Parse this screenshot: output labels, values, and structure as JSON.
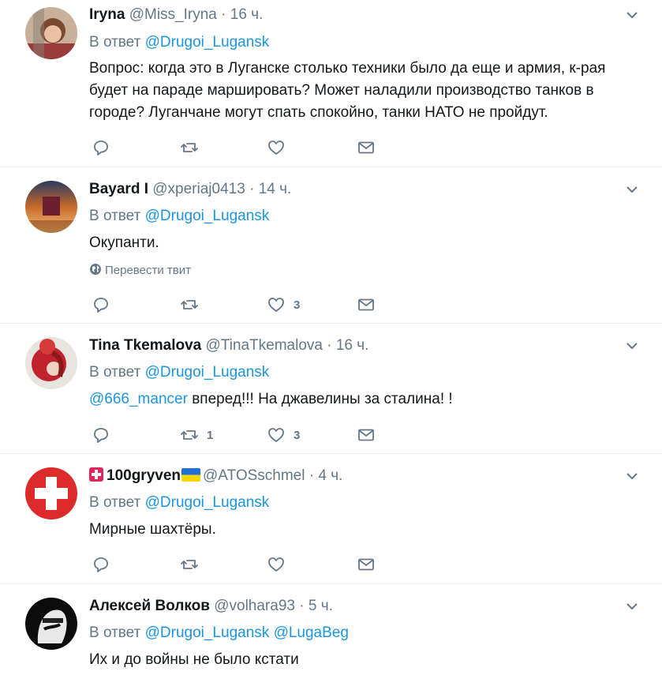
{
  "tweets": [
    {
      "name": "Iryna",
      "handle": "@Miss_Iryna",
      "dot": "·",
      "time": "16 ч.",
      "reply_prefix": "В ответ",
      "reply_to": "@Drugoi_Lugansk",
      "text": "Вопрос: когда это в Луганске столько техники было да еще и армия, к-рая будет на параде маршировать? Может наладили производство танков в городе? Луганчане могут спать спокойно, танки НАТО не пройдут.",
      "retweets": "",
      "likes": ""
    },
    {
      "name": "Bayard I",
      "handle": "@xperiaj0413",
      "dot": "·",
      "time": "14 ч.",
      "reply_prefix": "В ответ",
      "reply_to": "@Drugoi_Lugansk",
      "text": "Окупанти.",
      "translate": "Перевести твит",
      "retweets": "",
      "likes": "3"
    },
    {
      "name": "Tina Tkemalova",
      "handle": "@TinaTkemalova",
      "dot": "·",
      "time": "16 ч.",
      "reply_prefix": "В ответ",
      "reply_to": "@Drugoi_Lugansk",
      "text_mention": "@666_mancer",
      "text": " вперед!!! На джавелины за сталина! !",
      "retweets": "1",
      "likes": "3"
    },
    {
      "name": "100gryven",
      "handle": "@ATOSschmel",
      "dot": "·",
      "time": "4 ч.",
      "reply_prefix": "В ответ",
      "reply_to": "@Drugoi_Lugansk",
      "text": "Мирные шахтёры.",
      "retweets": "",
      "likes": ""
    },
    {
      "name": "Алексей Волков",
      "handle": "@volhara93",
      "dot": "·",
      "time": "5 ч.",
      "reply_prefix": "В ответ",
      "reply_to": "@Drugoi_Lugansk",
      "reply_to_2": "@LugaBeg",
      "text": "Их и до войны не было кстати"
    }
  ],
  "colors": {
    "link": "#1b95e0",
    "muted": "#657786",
    "text": "#14171a",
    "divider": "#e6ecf0"
  },
  "icons": [
    "reply-icon",
    "retweet-icon",
    "like-icon",
    "direct-message-icon",
    "chevron-down-icon",
    "globe-icon"
  ]
}
